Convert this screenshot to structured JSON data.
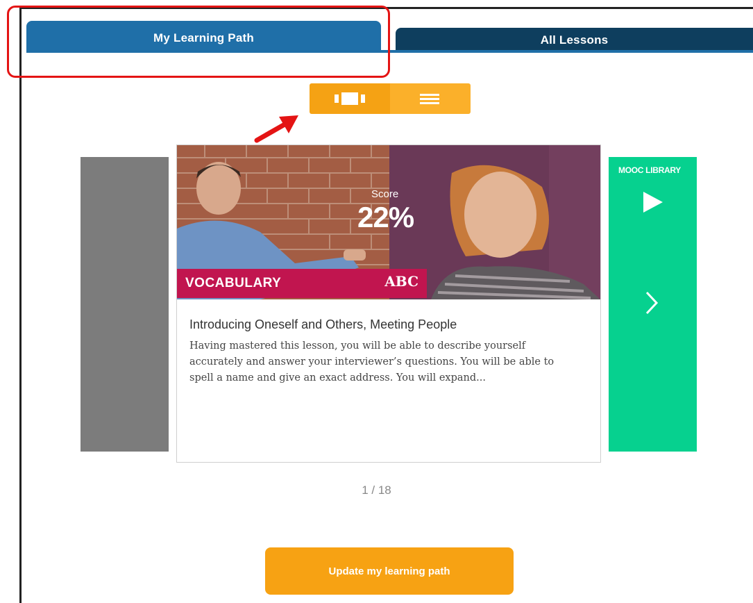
{
  "tabs": [
    {
      "label": "My Learning Path",
      "active": true
    },
    {
      "label": "All Lessons",
      "active": false
    }
  ],
  "view_toggle": {
    "modes": [
      {
        "name": "carousel-view",
        "icon": "carousel-icon",
        "active": true
      },
      {
        "name": "list-view",
        "icon": "list-icon",
        "active": false
      }
    ]
  },
  "side_panel_right": {
    "label": "MOOC LIBRARY",
    "icons": [
      "play-icon",
      "chevron-right-icon"
    ]
  },
  "card": {
    "score_label": "Score",
    "score_value": "22%",
    "category": "VOCABULARY",
    "category_icon": "ABC",
    "title": "Introducing Oneself and Others, Meeting People",
    "description": "Having mastered this lesson, you will be able to describe yourself accurately and answer your interviewer’s questions. You will be able to spell a name and give an exact address. You will expand..."
  },
  "pager": "1 / 18",
  "update_button": "Update my learning path",
  "colors": {
    "tab_active": "#1f6fa8",
    "tab_inactive": "#0e3e5e",
    "orange": "#f7a213",
    "magenta": "#c1154f",
    "green": "#06d18f",
    "highlight": "#e41414"
  }
}
